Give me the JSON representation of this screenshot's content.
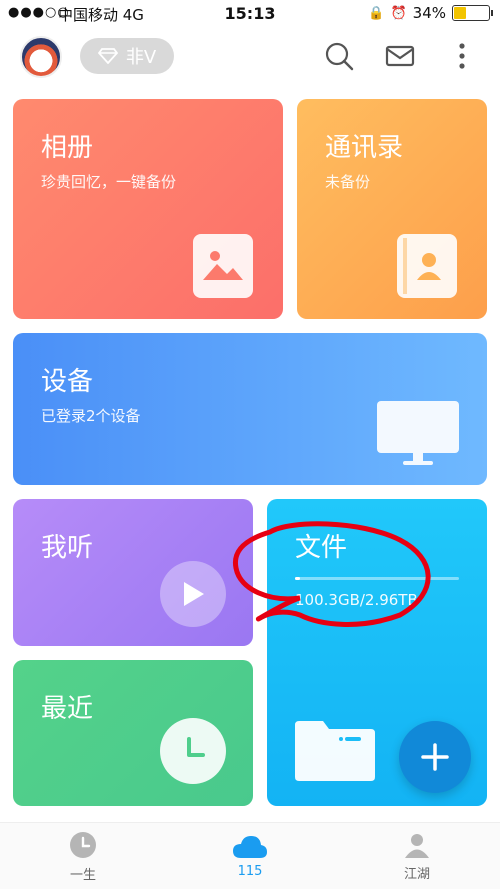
{
  "status_bar": {
    "signal": "●●●○○",
    "carrier": "中国移动  4G",
    "time": "15:13",
    "battery": "34%",
    "battery_level": 0.34
  },
  "header": {
    "vip_label": "非V",
    "icons": [
      "search-icon",
      "mail-icon",
      "more-icon"
    ]
  },
  "cards": {
    "album": {
      "title": "相册",
      "subtitle": "珍贵回忆，一键备份"
    },
    "contacts": {
      "title": "通讯录",
      "subtitle": "未备份"
    },
    "devices": {
      "title": "设备",
      "subtitle": "已登录2个设备"
    },
    "listen": {
      "title": "我听"
    },
    "files": {
      "title": "文件",
      "usage": "100.3GB/2.96TB",
      "usage_fraction": 0.033
    },
    "recent": {
      "title": "最近"
    }
  },
  "bottom_nav": {
    "items": [
      {
        "label": "一生",
        "icon": "clock-icon"
      },
      {
        "label": "115",
        "icon": "cloud-icon",
        "active": true
      },
      {
        "label": "江湖",
        "icon": "people-icon"
      }
    ]
  },
  "colors": {
    "album": "#fc7a6c",
    "contacts": "#feb155",
    "devices": "#5aa3fb",
    "listen": "#a882f5",
    "files": "#1abdf7",
    "recent": "#4fce8c",
    "accent": "#1a9cf0"
  }
}
